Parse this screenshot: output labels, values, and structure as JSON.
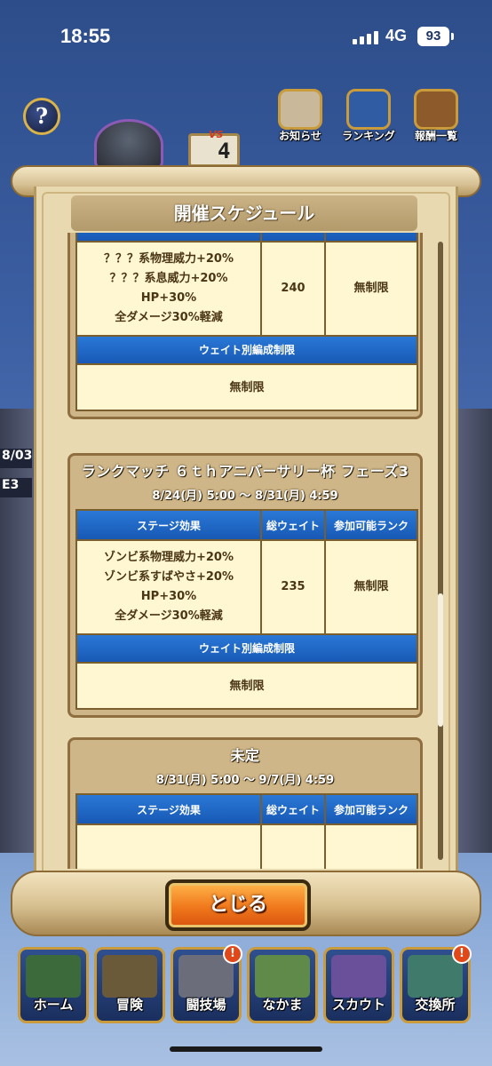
{
  "status": {
    "time": "18:55",
    "network": "4G",
    "battery": "93"
  },
  "top_bar": {
    "help": "?",
    "versus_label": "VS",
    "versus_number": "4",
    "icons": [
      {
        "label": "お知らせ",
        "icon": "mail-icon",
        "color": "#c9b99a"
      },
      {
        "label": "ランキング",
        "icon": "crown-icon",
        "color": "#2f5ca3"
      },
      {
        "label": "報酬一覧",
        "icon": "treasure-chest-icon",
        "color": "#8d5a2b"
      }
    ]
  },
  "side": {
    "left_date": "8/03",
    "left_rank": "E3"
  },
  "panel": {
    "title": "開催スケジュール",
    "headers": {
      "effect": "ステージ効果",
      "weight": "総ウェイト",
      "rank": "参加可能ランク"
    },
    "weight_limit_label": "ウェイト別編成制限",
    "cards": [
      {
        "title": "",
        "period": "",
        "effects": [
          "？？？系物理威力+20%",
          "？？？系息威力+20%",
          "HP+30%",
          "全ダメージ30%軽減"
        ],
        "total_weight": "240",
        "rank": "無制限",
        "weight_limit": "無制限"
      },
      {
        "title": "ランクマッチ ６ｔｈアニバーサリー杯 フェーズ3",
        "period": "8/24(月) 5:00 〜 8/31(月) 4:59",
        "effects": [
          "ゾンビ系物理威力+20%",
          "ゾンビ系すばやさ+20%",
          "HP+30%",
          "全ダメージ30%軽減"
        ],
        "total_weight": "235",
        "rank": "無制限",
        "weight_limit": "無制限"
      },
      {
        "title": "未定",
        "period": "8/31(月) 5:00 〜 9/7(月) 4:59",
        "effects": [],
        "total_weight": "",
        "rank": "",
        "weight_limit": ""
      }
    ],
    "close_label": "とじる",
    "scroll_position": 0.58
  },
  "bottom_nav": [
    {
      "label": "ホーム",
      "icon": "tent-icon",
      "badge": "",
      "color": "#3d6a3a"
    },
    {
      "label": "冒険",
      "icon": "wagon-icon",
      "badge": "",
      "color": "#6b5a3a"
    },
    {
      "label": "闘技場",
      "icon": "arena-icon",
      "badge": "!",
      "color": "#6b6e7a"
    },
    {
      "label": "なかま",
      "icon": "monster-icon",
      "badge": "",
      "color": "#5f8a4a"
    },
    {
      "label": "スカウト",
      "icon": "scout-icon",
      "badge": "",
      "color": "#6a4f9a"
    },
    {
      "label": "交換所",
      "icon": "shop-icon",
      "badge": "!",
      "color": "#3f7a6a"
    }
  ]
}
